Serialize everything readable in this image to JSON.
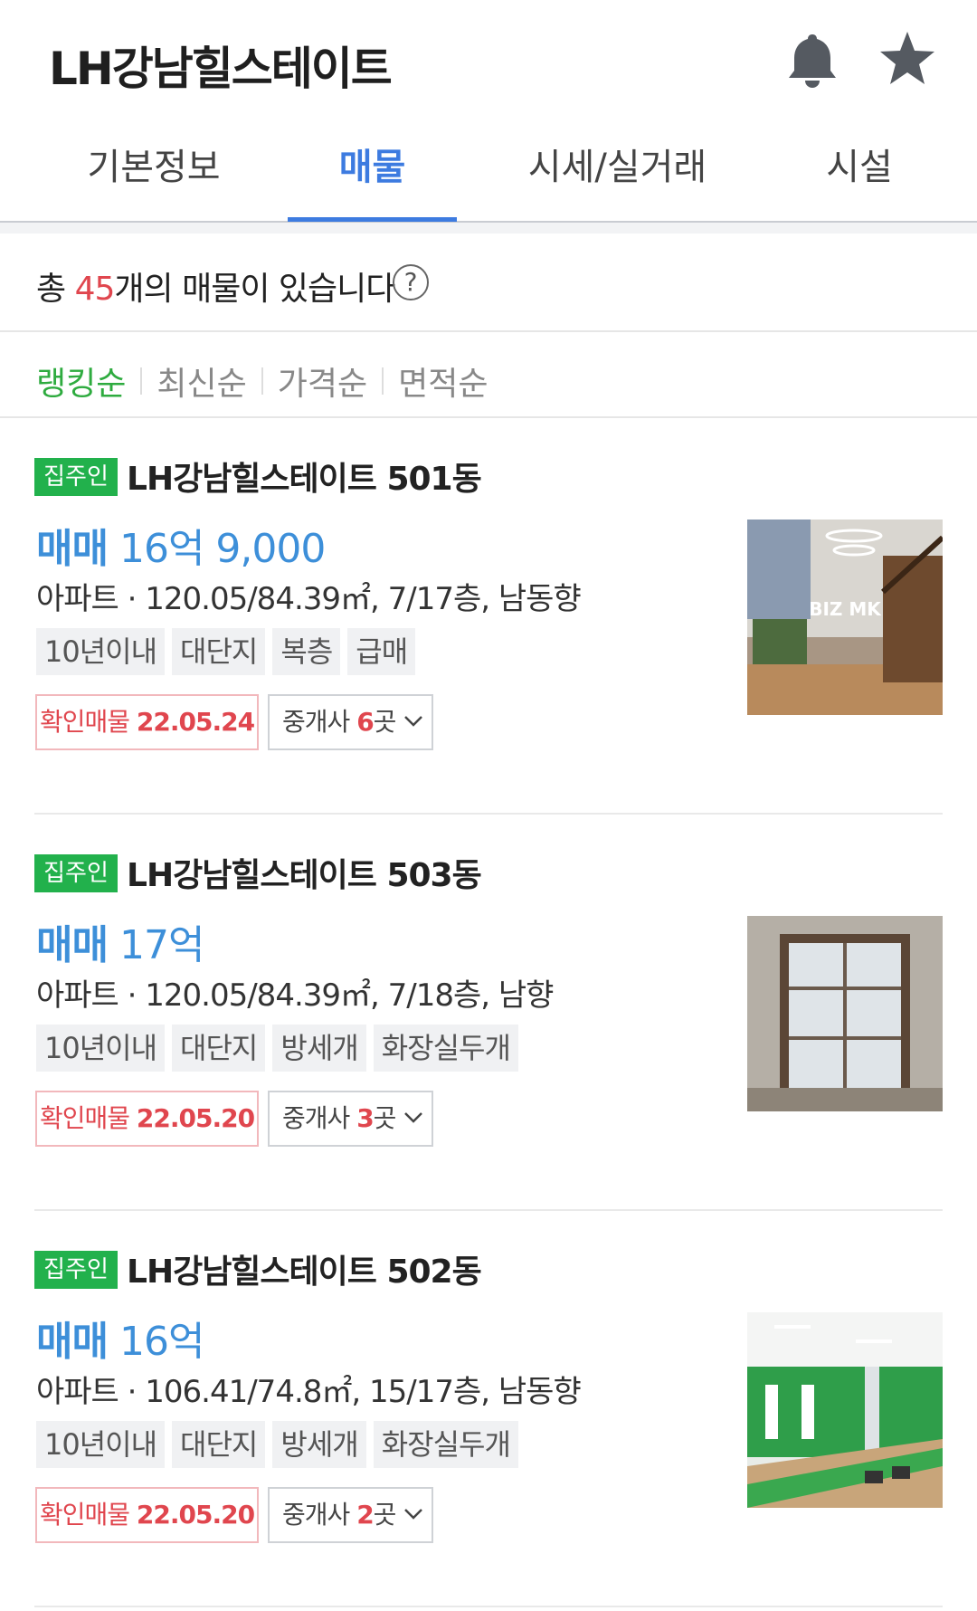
{
  "header": {
    "title": "LH강남힐스테이트",
    "icons": [
      "bell-icon",
      "star-icon"
    ]
  },
  "tabs": [
    {
      "label": "기본정보",
      "active": false
    },
    {
      "label": "매물",
      "active": true
    },
    {
      "label": "시세/실거래",
      "active": false
    },
    {
      "label": "시설",
      "active": false
    }
  ],
  "summary": {
    "prefix": "총 ",
    "count": "45",
    "suffix": "개의 매물이 있습니다",
    "help_label": "?"
  },
  "sort_options": [
    {
      "label": "랭킹순",
      "active": true
    },
    {
      "label": "최신순",
      "active": false
    },
    {
      "label": "가격순",
      "active": false
    },
    {
      "label": "면적순",
      "active": false
    }
  ],
  "listings": [
    {
      "badge": "집주인",
      "title": "LH강남힐스테이트 501동",
      "deal_type": "매매",
      "price": "16억 9,000",
      "detail": "아파트 · 120.05/84.39㎡, 7/17층, 남동향",
      "tags": [
        "10년이내",
        "대단지",
        "복층",
        "급매"
      ],
      "confirm_label": "확인매물",
      "confirm_date": "22.05.24",
      "agents_label": "중개사",
      "agents_count": "6",
      "agents_unit": "곳",
      "photo_watermark": "BIZ MK"
    },
    {
      "badge": "집주인",
      "title": "LH강남힐스테이트 503동",
      "deal_type": "매매",
      "price": "17억",
      "detail": "아파트 · 120.05/84.39㎡, 7/18층, 남향",
      "tags": [
        "10년이내",
        "대단지",
        "방세개",
        "화장실두개"
      ],
      "confirm_label": "확인매물",
      "confirm_date": "22.05.20",
      "agents_label": "중개사",
      "agents_count": "3",
      "agents_unit": "곳"
    },
    {
      "badge": "집주인",
      "title": "LH강남힐스테이트 502동",
      "deal_type": "매매",
      "price": "16억",
      "detail": "아파트 · 106.41/74.8㎡, 15/17층, 남동향",
      "tags": [
        "10년이내",
        "대단지",
        "방세개",
        "화장실두개"
      ],
      "confirm_label": "확인매물",
      "confirm_date": "22.05.20",
      "agents_label": "중개사",
      "agents_count": "2",
      "agents_unit": "곳"
    }
  ],
  "colors": {
    "accent_blue": "#3d7be0",
    "price_blue": "#3d8fd9",
    "owner_green": "#22b14c",
    "sort_green": "#2eab3f",
    "alert_red": "#e0464e"
  }
}
